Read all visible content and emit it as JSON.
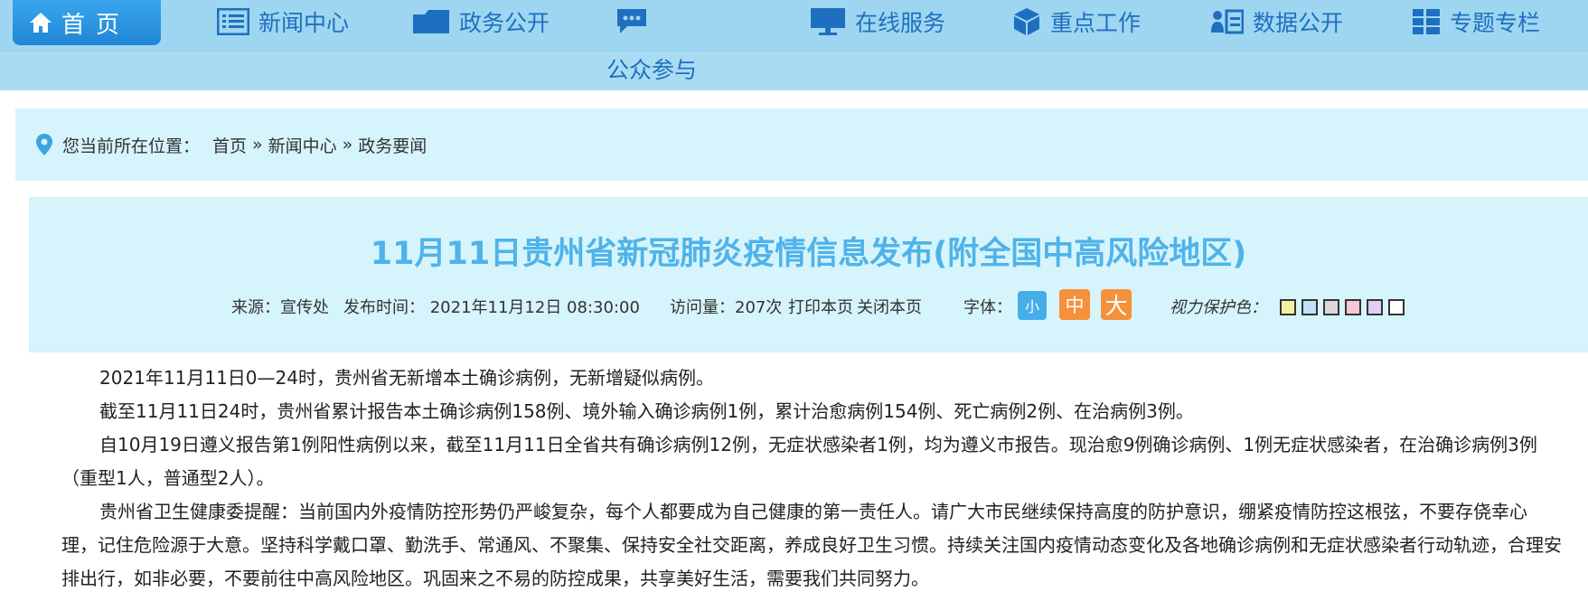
{
  "nav": {
    "home": "首页",
    "items": [
      "新闻中心",
      "政务公开",
      "在线服务",
      "重点工作",
      "数据公开",
      "专题专栏"
    ],
    "sub": "公众参与"
  },
  "breadcrumb": {
    "prefix": "您当前所在位置：",
    "items": [
      "首页",
      "新闻中心",
      "政务要闻"
    ],
    "sep": "»"
  },
  "article": {
    "title": "11月11日贵州省新冠肺炎疫情信息发布(附全国中高风险地区)",
    "source": "来源：宣传处",
    "publish": "发布时间：  2021年11月12日 08:30:00",
    "visits": "访问量：207次",
    "print": "打印本页",
    "close": "关闭本页",
    "font_label": "字体：",
    "font_small": "小",
    "font_mid": "中",
    "font_large": "大",
    "eye_label": "视力保护色：",
    "eye_colors": [
      "#f7f0a0",
      "#bfe3f5",
      "#d8d8d8",
      "#f6c8d5",
      "#e2cdf3",
      "#ffffff"
    ],
    "paragraphs": [
      "2021年11月11日0—24时，贵州省无新增本土确诊病例，无新增疑似病例。",
      "截至11月11日24时，贵州省累计报告本土确诊病例158例、境外输入确诊病例1例，累计治愈病例154例、死亡病例2例、在治病例3例。",
      "自10月19日遵义报告第1例阳性病例以来，截至11月11日全省共有确诊病例12例，无症状感染者1例，均为遵义市报告。现治愈9例确诊病例、1例无症状感染者，在治确诊病例3例（重型1人，普通型2人）。",
      "贵州省卫生健康委提醒：当前国内外疫情防控形势仍严峻复杂，每个人都要成为自己健康的第一责任人。请广大市民继续保持高度的防护意识，绷紧疫情防控这根弦，不要存侥幸心理，记住危险源于大意。坚持科学戴口罩、勤洗手、常通风、不聚集、保持安全社交距离，养成良好卫生习惯。持续关注国内疫情动态变化及各地确诊病例和无症状感染者行动轨迹，合理安排出行，如非必要，不要前往中高风险地区。巩固来之不易的防控成果，共享美好生活，需要我们共同努力。"
    ]
  },
  "colors": {
    "nav_bg": "#9ed6f1",
    "nav_text": "#1f6fc0",
    "title": "#4fb3ea",
    "panel": "#d6f4fb",
    "font_small_bg": "#45aee8",
    "font_big_bg": "#f5903b"
  }
}
